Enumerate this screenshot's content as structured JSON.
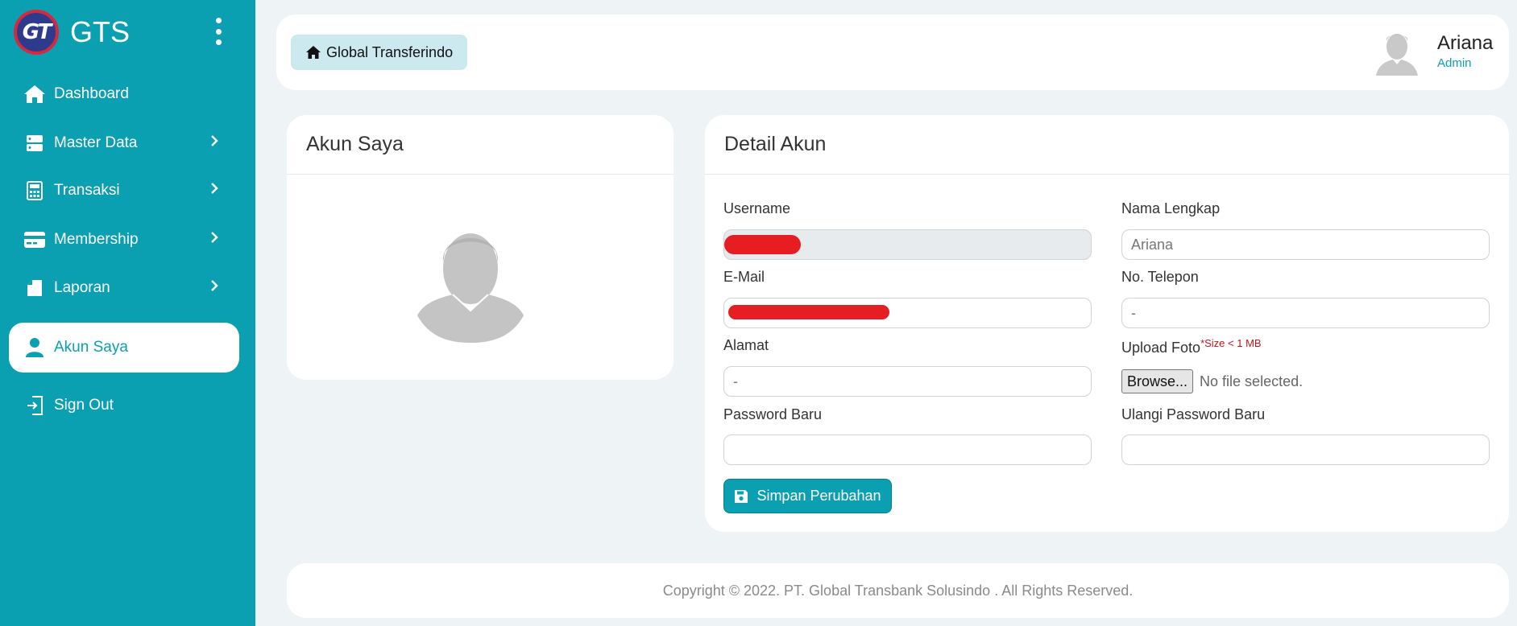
{
  "brand": {
    "logo_text": "GT",
    "name": "GTS"
  },
  "sidebar": {
    "items": [
      {
        "label": "Dashboard",
        "icon": "home-icon"
      },
      {
        "label": "Master Data",
        "icon": "server-icon"
      },
      {
        "label": "Transaksi",
        "icon": "calculator-icon"
      },
      {
        "label": "Membership",
        "icon": "credit-card-icon"
      },
      {
        "label": "Laporan",
        "icon": "file-icon"
      },
      {
        "label": "Akun Saya",
        "icon": "user-icon"
      },
      {
        "label": "Sign Out",
        "icon": "sign-out-icon"
      }
    ]
  },
  "header": {
    "breadcrumb": "Global Transferindo",
    "user_name": "Ariana",
    "user_role": "Admin"
  },
  "profile_card": {
    "title": "Akun Saya"
  },
  "detail": {
    "title": "Detail Akun",
    "username_label": "Username",
    "fullname_label": "Nama Lengkap",
    "fullname_value": "Ariana",
    "email_label": "E-Mail",
    "phone_label": "No. Telepon",
    "phone_value": "-",
    "address_label": "Alamat",
    "address_value": "-",
    "upload_label": "Upload Foto",
    "upload_note": "*Size < 1 MB",
    "browse_label": "Browse...",
    "file_status": "No file selected.",
    "new_password_label": "Password Baru",
    "repeat_password_label": "Ulangi Password Baru",
    "save_label": "Simpan Perubahan"
  },
  "footer": {
    "text": "Copyright © 2022. PT. Global Transbank Solusindo . All Rights Reserved."
  },
  "colors": {
    "primary": "#0aa0b1",
    "background": "#eef3f6",
    "redaction": "#e61e24"
  }
}
